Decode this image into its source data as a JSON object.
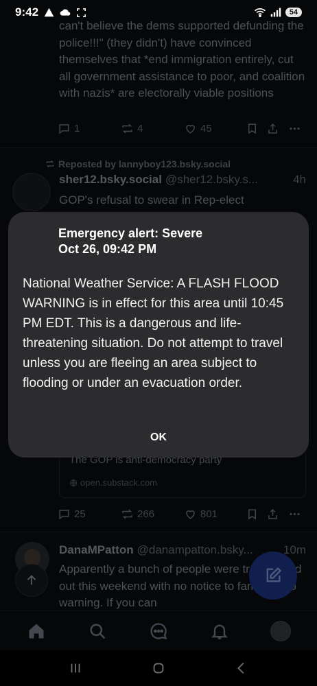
{
  "status_bar": {
    "time": "9:42",
    "battery": "54"
  },
  "feed": {
    "post1": {
      "text": "can't believe the dems supported defunding the police!!!\" (they didn't) have convinced themselves that *end immigration entirely, cut all government assistance to poor, and coalition with nazis* are electorally viable positions",
      "replies": "1",
      "reposts": "4",
      "likes": "45"
    },
    "post2": {
      "repost_label": "Reposted by lannyboy123.bsky.social",
      "name": "sher12.bsky.social",
      "handle": "@sher12.bsky.s...",
      "time": "4h",
      "text": "GOP's refusal to swear in Rep-elect",
      "link_title": "The GOP is anti-democracy party",
      "link_domain": "open.substack.com",
      "replies": "25",
      "reposts": "266",
      "likes": "801"
    },
    "post3": {
      "name": "DanaMPatton",
      "handle": "@danampatton.bsky...",
      "time": "10m",
      "text": "Apparently a bunch of people were transported out this weekend with no notice to families, no warning. If you can"
    }
  },
  "alert": {
    "title": "Emergency alert: Severe",
    "date": "Oct 26, 09:42 PM",
    "body": "National Weather Service: A FLASH FLOOD WARNING is in effect for this area until 10:45 PM EDT. This is a dangerous and life-threatening situation. Do not attempt to travel unless you are fleeing an area subject to flooding or under an evacuation order.",
    "ok_label": "OK"
  },
  "icons": {
    "nav": [
      "home-icon",
      "search-icon",
      "chat-icon",
      "notifications-icon",
      "profile-avatar"
    ],
    "system": [
      "recents-icon",
      "home-button-icon",
      "back-icon"
    ]
  },
  "colors": {
    "background": "#0b0d10",
    "dialog": "#2c2c2e",
    "fab": "#1f3a8f"
  }
}
